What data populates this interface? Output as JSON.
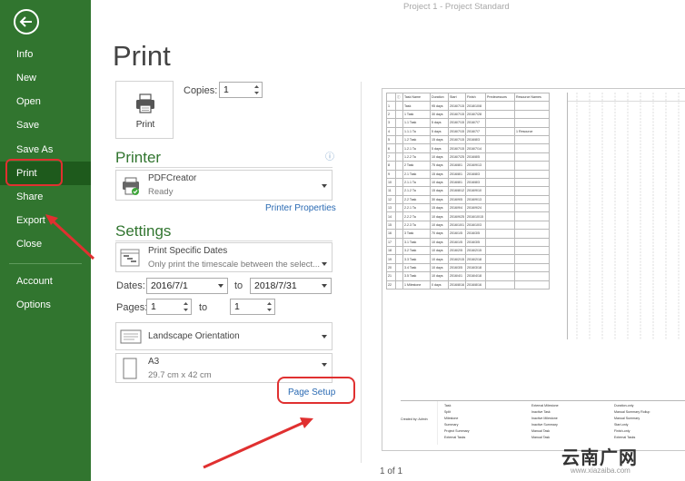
{
  "window_title": "Project 1 - Project Standard",
  "nav": {
    "items": [
      "Info",
      "New",
      "Open",
      "Save",
      "Save As",
      "Print",
      "Share",
      "Export",
      "Close"
    ],
    "footer_items": [
      "Account",
      "Options"
    ],
    "active": "Print"
  },
  "page_title": "Print",
  "print_button_label": "Print",
  "copies": {
    "label": "Copies:",
    "value": "1"
  },
  "printer": {
    "section_title": "Printer",
    "info_icon": "ⓘ",
    "name": "PDFCreator",
    "status": "Ready",
    "properties_link": "Printer Properties"
  },
  "settings": {
    "section_title": "Settings",
    "range_main": "Print Specific Dates",
    "range_sub": "Only print the timescale between the select...",
    "dates_label": "Dates:",
    "date_from": "2016/7/1",
    "to_label": "to",
    "date_to": "2018/7/31",
    "pages_label": "Pages:",
    "page_from": "1",
    "page_to": "1",
    "orientation": "Landscape Orientation",
    "paper_size": "A3",
    "paper_dims": "29.7 cm x 42 cm",
    "page_setup_link": "Page Setup"
  },
  "preview": {
    "page_indicator": "1 of 1",
    "headers": [
      "",
      "ⓘ",
      "Task Name",
      "Duration",
      "Start",
      "Finish",
      "Predecessors",
      "Resource Names"
    ],
    "rows": [
      [
        "1",
        "",
        "Task",
        "95 days",
        "2016/7/15",
        "2018/10/8",
        "",
        ""
      ],
      [
        "2",
        "",
        "1 Task",
        "30 days",
        "2016/7/15",
        "2016/7/28",
        "",
        ""
      ],
      [
        "3",
        "",
        "1.1 Task",
        "5 days",
        "2016/7/15",
        "2016/7/7",
        "",
        ""
      ],
      [
        "4",
        "",
        "1.1.1 Ta",
        "5 days",
        "2016/7/15",
        "2016/7/7",
        "",
        "1 Resource"
      ],
      [
        "5",
        "",
        "1.2 Task",
        "15 days",
        "2016/7/15",
        "2016/8/3",
        "",
        ""
      ],
      [
        "6",
        "",
        "1.2.1 Ta",
        "5 days",
        "2016/7/15",
        "2016/7/14",
        "",
        ""
      ],
      [
        "7",
        "",
        "1.2.2 Ta",
        "10 days",
        "2016/7/25",
        "2016/8/5",
        "",
        ""
      ],
      [
        "8",
        "",
        "2 Task",
        "75 days",
        "2016/8/1",
        "2016/9/13",
        "",
        ""
      ],
      [
        "9",
        "",
        "2.1 Task",
        "15 days",
        "2016/8/1",
        "2016/8/3",
        "",
        ""
      ],
      [
        "10",
        "",
        "2.1.1 Ta",
        "10 days",
        "2016/8/1",
        "2016/8/3",
        "",
        ""
      ],
      [
        "11",
        "",
        "2.1.2 Ta",
        "15 days",
        "2016/8/12",
        "2016/9/10",
        "",
        ""
      ],
      [
        "12",
        "",
        "2.2 Task",
        "30 days",
        "2016/9/5",
        "2016/9/13",
        "",
        ""
      ],
      [
        "13",
        "",
        "2.2.1 Ta",
        "15 days",
        "2016/9/4",
        "2016/9/24",
        "",
        ""
      ],
      [
        "14",
        "",
        "2.2.2 Ta",
        "10 days",
        "2016/9/25",
        "2016/10/15",
        "",
        ""
      ],
      [
        "15",
        "",
        "2.2.3 Ta",
        "10 days",
        "2016/10/1",
        "2016/10/3",
        "",
        ""
      ],
      [
        "16",
        "",
        "3 Task",
        "70 days",
        "2016/1/5",
        "2016/3/5",
        "",
        ""
      ],
      [
        "17",
        "",
        "3.1 Task",
        "10 days",
        "2016/1/5",
        "2016/3/5",
        "",
        ""
      ],
      [
        "18",
        "",
        "3.2 Task",
        "10 days",
        "2016/2/5",
        "2016/2/15",
        "",
        ""
      ],
      [
        "19",
        "",
        "3.3 Task",
        "10 days",
        "2016/2/15",
        "2016/2/18",
        "",
        ""
      ],
      [
        "20",
        "",
        "3.4 Task",
        "10 days",
        "2016/3/5",
        "2016/3/18",
        "",
        ""
      ],
      [
        "21",
        "",
        "3.5 Task",
        "10 days",
        "2016/4/1",
        "2016/4/18",
        "",
        ""
      ],
      [
        "22",
        "",
        "1 Milestone",
        "0 days",
        "2016/8/16",
        "2016/8/16",
        "",
        ""
      ]
    ],
    "legend": {
      "col1": [
        "Task",
        "Split",
        "Milestone",
        "Summary",
        "Project Summary",
        "External Tasks"
      ],
      "col2": [
        "External Milestone",
        "Inactive Task",
        "Inactive Milestone",
        "Inactive Summary",
        "Manual Task",
        "Manual Task"
      ],
      "col3": [
        "Duration-only",
        "Manual Summary Rollup",
        "Manual Summary",
        "Start-only",
        "Finish-only",
        "External Tasks"
      ],
      "created_by": "Created by: Admin"
    }
  },
  "watermark": {
    "main": "云南广网",
    "sub": "www.xiazaiba.com"
  },
  "colors": {
    "sidebar": "#31752f",
    "sidebar_active": "#1e5a1c",
    "accent_green": "#31752f",
    "link_blue": "#2a6ab3",
    "annotation_red": "#e03030"
  }
}
